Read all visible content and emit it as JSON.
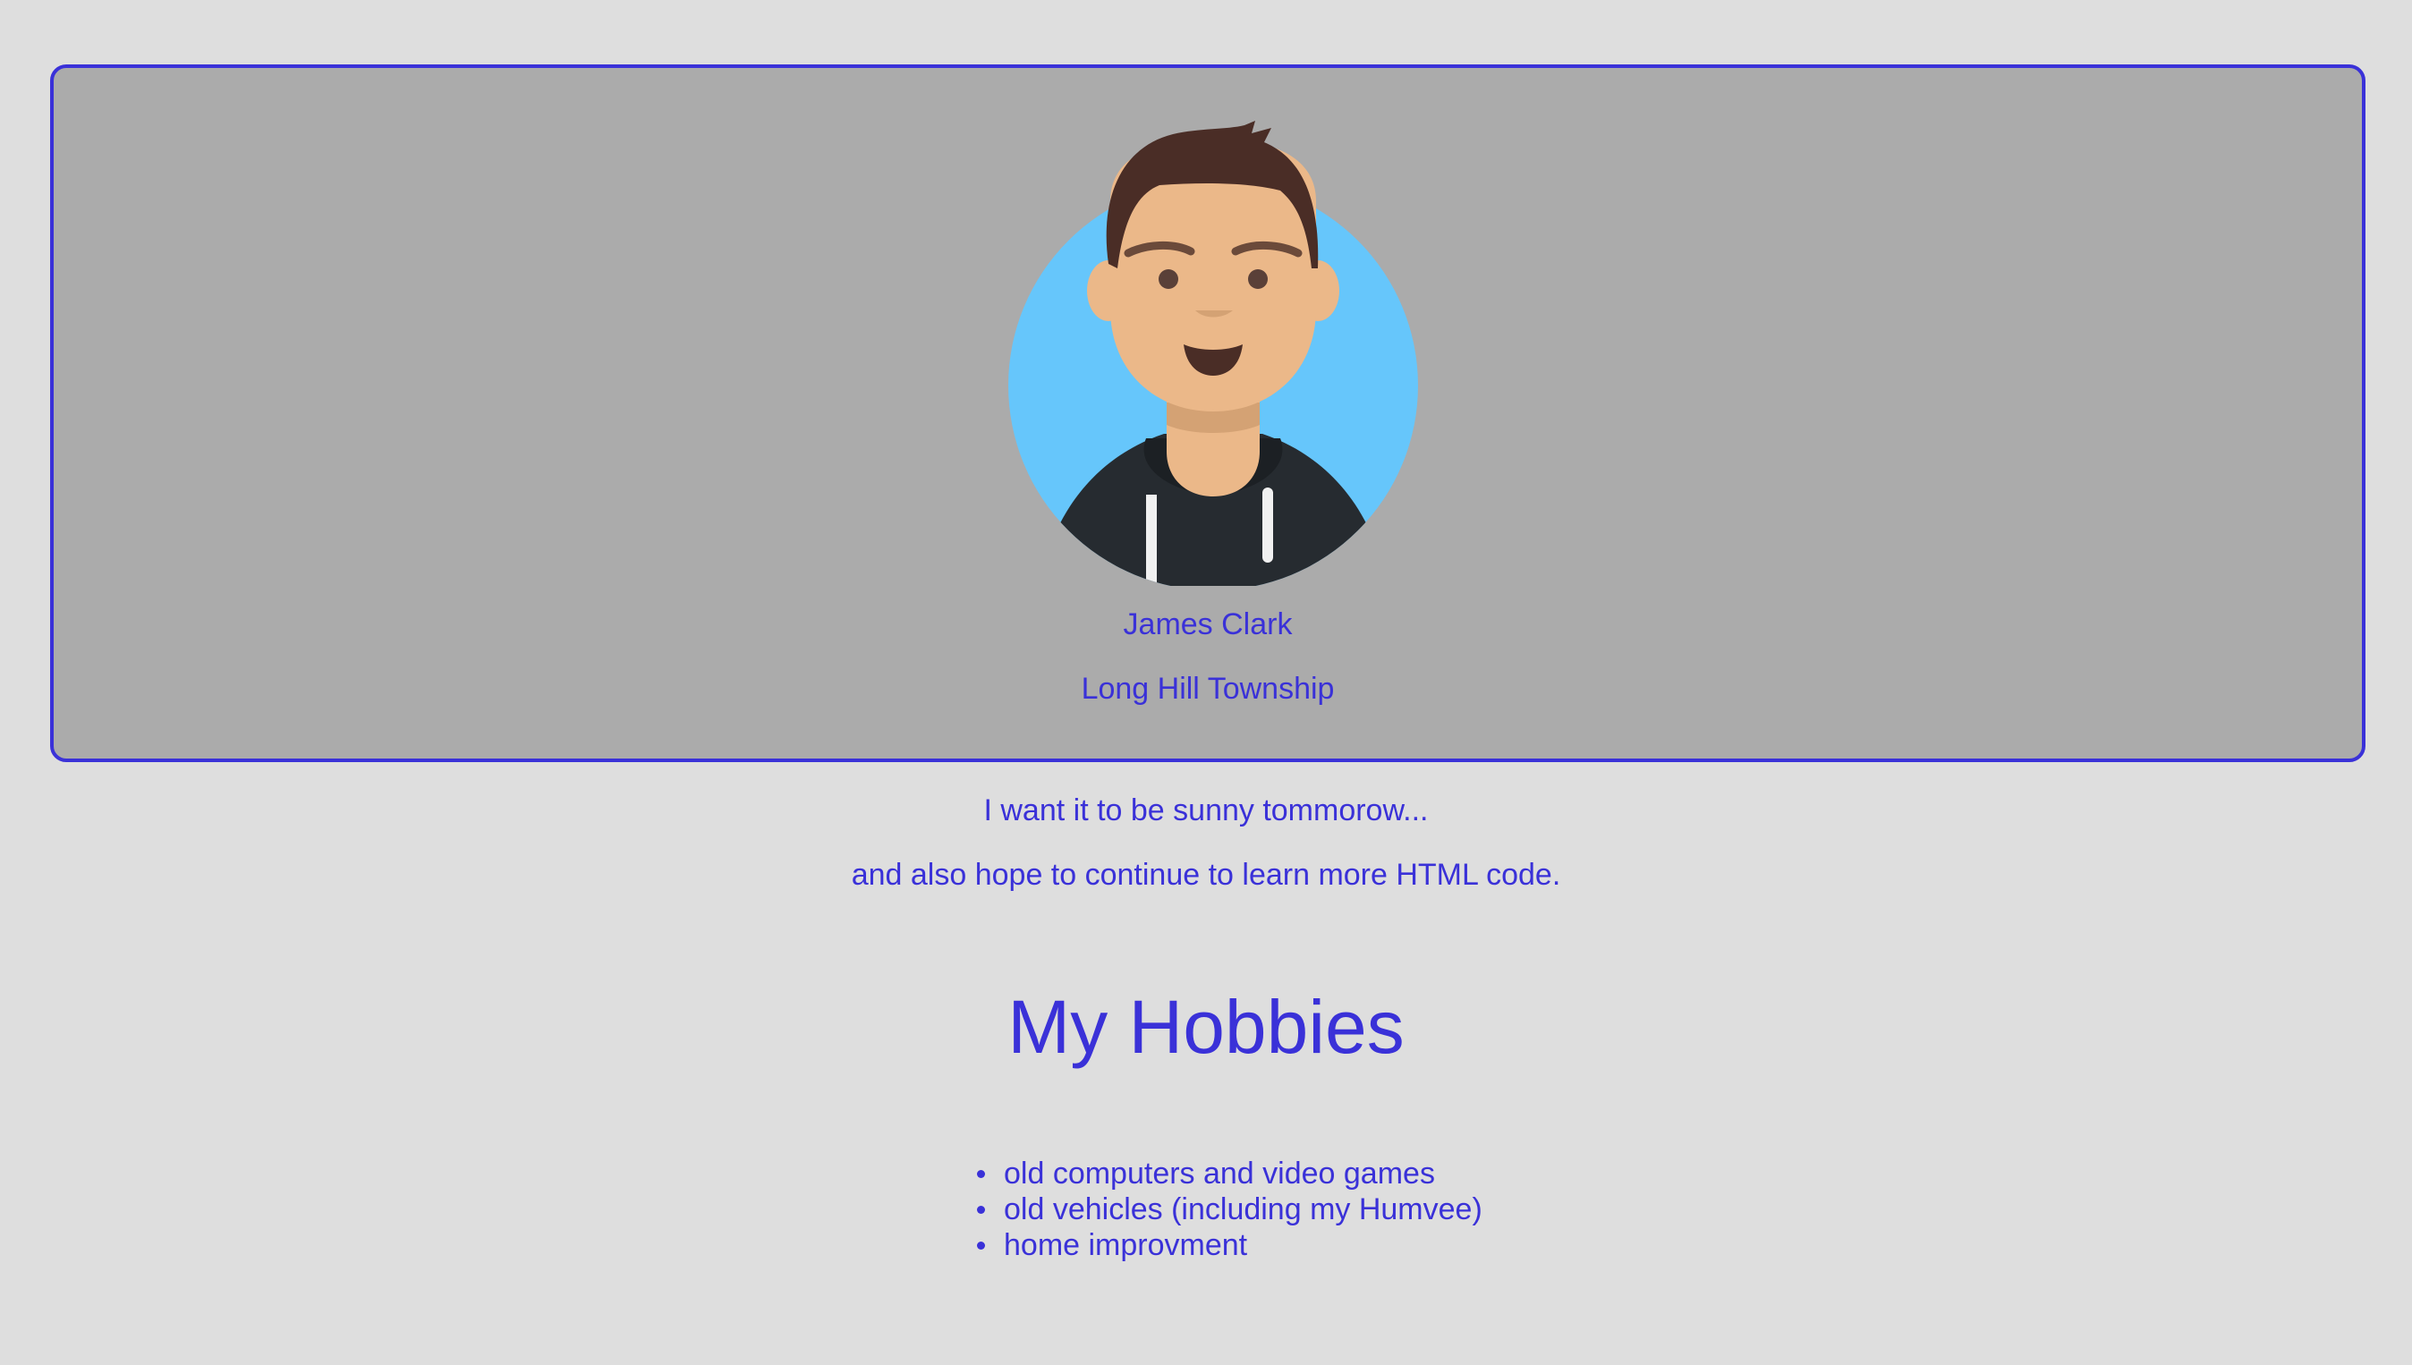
{
  "profile": {
    "name": "James Clark",
    "location": "Long Hill Township",
    "avatar_icon": "person-avatar-icon"
  },
  "message": {
    "line1": "I want it to be sunny tommorow...",
    "line2": "and also hope to continue to learn more HTML code."
  },
  "hobbies": {
    "heading": "My Hobbies",
    "items": [
      "old computers and video games",
      "old vehicles (including my Humvee)",
      "home improvment"
    ]
  },
  "colors": {
    "background": "#dedede",
    "card_background": "#ababab",
    "accent": "#3a31d8",
    "avatar_circle": "#66c6fb",
    "skin": "#ebb889",
    "hair": "#4a2d26",
    "hoodie": "#262b30"
  }
}
